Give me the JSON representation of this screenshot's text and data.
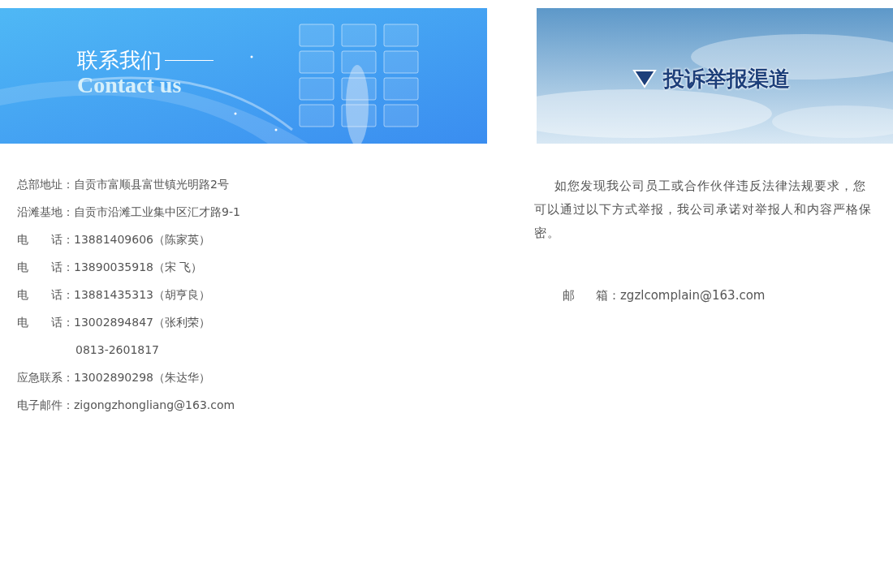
{
  "contact_banner": {
    "title": "联系我们",
    "subtitle": "Contact us"
  },
  "complaint_banner": {
    "title": "投诉举报渠道"
  },
  "contact_rows": [
    {
      "label": "总部地址",
      "value": "：自贡市富顺县富世镇光明路2号"
    },
    {
      "label": "沿滩基地",
      "value": "：自贡市沿滩工业集中区汇才路9-1"
    },
    {
      "label": "电话",
      "value": "：13881409606（陈家英）"
    },
    {
      "label": "电话",
      "value": "：13890035918（宋 飞）"
    },
    {
      "label": "电话",
      "value": "：13881435313（胡亨良）"
    },
    {
      "label": "电话",
      "value": "：13002894847（张利荣）"
    },
    {
      "value": "0813-2601817"
    },
    {
      "label": "应急联系",
      "value": "：13002890298（朱达华）"
    },
    {
      "label": "电子邮件",
      "value": "：zigongzhongliang@163.com"
    }
  ],
  "complaint_text": "如您发现我公司员工或合作伙伴违反法律法规要求，您可以通过以下方式举报，我公司承诺对举报人和内容严格保密。",
  "complaint_email": {
    "label": "邮箱",
    "value": "：zgzlcomplain@163.com"
  }
}
